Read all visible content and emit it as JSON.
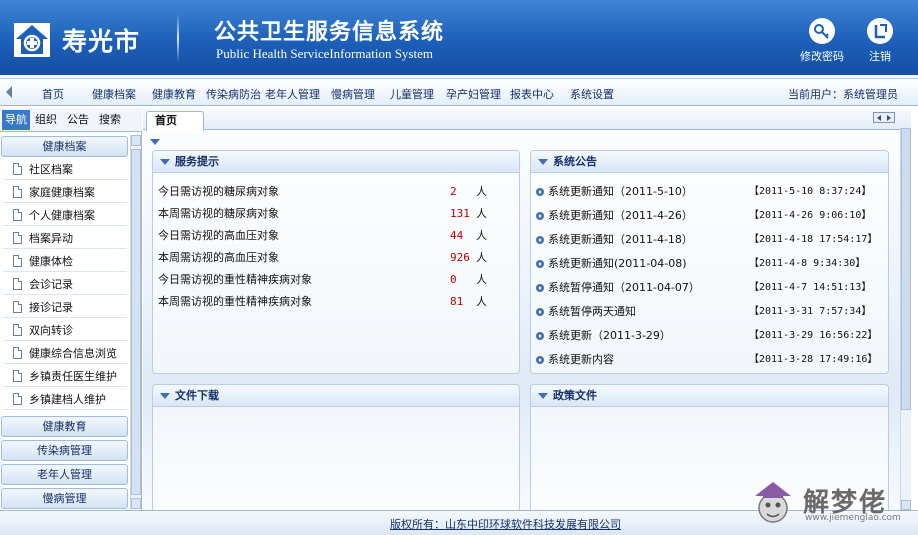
{
  "header": {
    "city": "寿光市",
    "system_title": "公共卫生服务信息系统",
    "system_title_en": "Public Health ServiceInformation System",
    "buttons": [
      {
        "label": "修改密码",
        "icon": "key-icon"
      },
      {
        "label": "注销",
        "icon": "logout-icon"
      }
    ]
  },
  "nav": {
    "items": [
      "首页",
      "健康档案",
      "健康教育",
      "传染病防治",
      "老年人管理",
      "慢病管理",
      "儿童管理",
      "孕产妇管理",
      "报表中心",
      "系统设置"
    ],
    "current_user": "当前用户：系统管理员"
  },
  "sidebar": {
    "tabs": [
      "导航",
      "组织",
      "公告",
      "搜索"
    ],
    "active_tab": "导航",
    "open_section": "健康档案",
    "items": [
      "社区档案",
      "家庭健康档案",
      "个人健康档案",
      "档案异动",
      "健康体检",
      "会诊记录",
      "接诊记录",
      "双向转诊",
      "健康综合信息浏览",
      "乡镇责任医生维护",
      "乡镇建档人维护"
    ],
    "sections": [
      "健康教育",
      "传染病管理",
      "老年人管理",
      "慢病管理"
    ]
  },
  "content": {
    "tab": "首页",
    "service_panel": {
      "title": "服务提示",
      "rows": [
        {
          "label": "今日需访视的糖尿病对象",
          "value": "2",
          "unit": "人"
        },
        {
          "label": "本周需访视的糖尿病对象",
          "value": "131",
          "unit": "人"
        },
        {
          "label": "今日需访视的高血压对象",
          "value": "44",
          "unit": "人"
        },
        {
          "label": "本周需访视的高血压对象",
          "value": "926",
          "unit": "人"
        },
        {
          "label": "今日需访视的重性精神疾病对象",
          "value": "0",
          "unit": "人"
        },
        {
          "label": "本周需访视的重性精神疾病对象",
          "value": "81",
          "unit": "人"
        }
      ]
    },
    "notice_panel": {
      "title": "系统公告",
      "rows": [
        {
          "title": "系统更新通知（2011-5-10）",
          "date": "【2011-5-10 8:37:24】"
        },
        {
          "title": "系统更新通知（2011-4-26）",
          "date": "【2011-4-26 9:06:10】"
        },
        {
          "title": "系统更新通知（2011-4-18）",
          "date": "【2011-4-18 17:54:17】"
        },
        {
          "title": "系统更新通知(2011-04-08)",
          "date": "【2011-4-8 9:34:30】"
        },
        {
          "title": "系统暂停通知（2011-04-07）",
          "date": "【2011-4-7 14:51:13】"
        },
        {
          "title": "系统暂停两天通知",
          "date": "【2011-3-31 7:57:34】"
        },
        {
          "title": "系统更新（2011-3-29）",
          "date": "【2011-3-29 16:56:22】"
        },
        {
          "title": "系统更新内容",
          "date": "【2011-3-28 17:49:16】"
        }
      ]
    },
    "download_panel": {
      "title": "文件下载"
    },
    "policy_panel": {
      "title": "政策文件"
    }
  },
  "footer": {
    "copyright": "版权所有：山东中印环球软件科技发展有限公司"
  },
  "watermark": {
    "text": "解梦佬",
    "url": "www.jiemenglao.com"
  },
  "colors": {
    "header_blue": "#1d5fb9",
    "value_red": "#c00000",
    "panel_title": "#15306b"
  }
}
